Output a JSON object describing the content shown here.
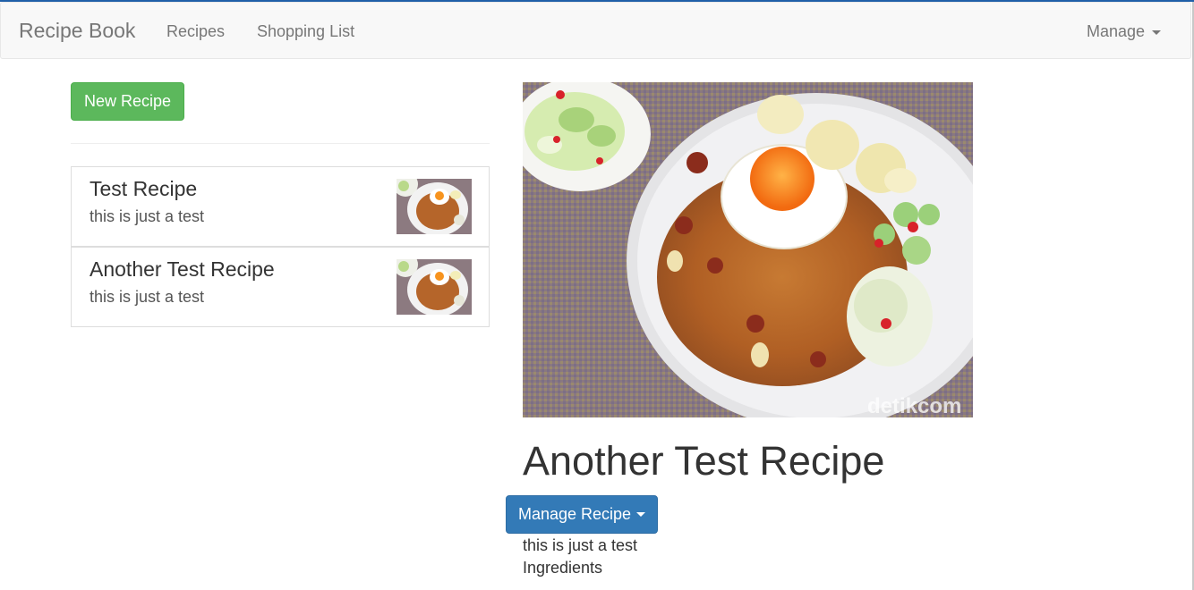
{
  "navbar": {
    "brand": "Recipe Book",
    "links": [
      "Recipes",
      "Shopping List"
    ],
    "manage_label": "Manage"
  },
  "sidebar": {
    "new_recipe_label": "New Recipe",
    "recipes": [
      {
        "name": "Test Recipe",
        "description": "this is just a test"
      },
      {
        "name": "Another Test Recipe",
        "description": "this is just a test"
      }
    ]
  },
  "detail": {
    "title": "Another Test Recipe",
    "manage_button": "Manage Recipe",
    "description": "this is just a test",
    "ingredients_label": "Ingredients",
    "image_watermark": "detikcom"
  },
  "colors": {
    "success": "#5cb85c",
    "primary": "#337ab7",
    "navbar_bg": "#f8f8f8",
    "nav_text": "#777777"
  }
}
